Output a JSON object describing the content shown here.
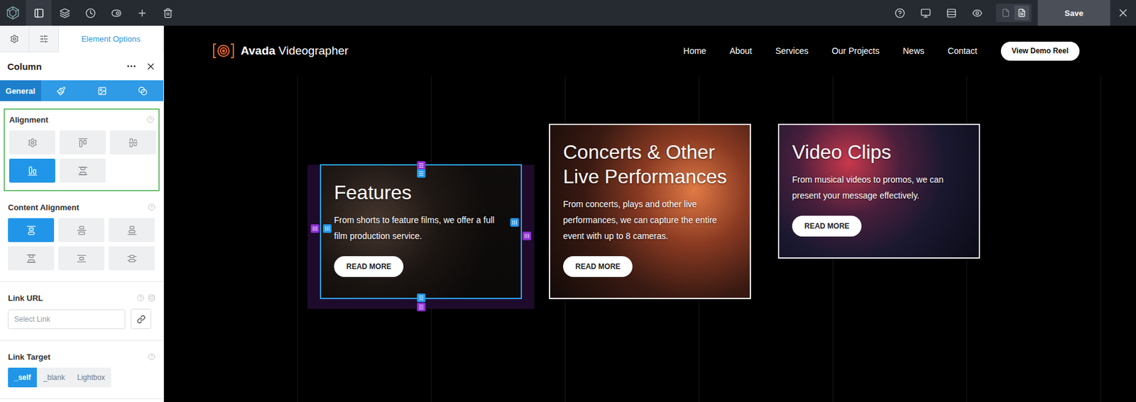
{
  "toolbar": {
    "tools": [
      {
        "kind": "panel",
        "selected": true
      },
      {
        "kind": "layers",
        "selected": false
      },
      {
        "kind": "history",
        "selected": false
      },
      {
        "kind": "toggles",
        "selected": false
      },
      {
        "kind": "add",
        "selected": false
      },
      {
        "kind": "delete",
        "selected": false
      }
    ],
    "view_tools": [
      {
        "kind": "help"
      },
      {
        "kind": "desktop"
      },
      {
        "kind": "rows"
      },
      {
        "kind": "preview"
      }
    ],
    "page_modes": [
      {
        "kind": "blank",
        "selected": false
      },
      {
        "kind": "page",
        "selected": true
      }
    ],
    "save": "Save"
  },
  "sidebar": {
    "tabs": [
      {
        "kind": "gear",
        "selected": false
      },
      {
        "kind": "sliders",
        "selected": false
      },
      {
        "kind": "text",
        "label": "Element Options",
        "selected": true
      }
    ],
    "panel_title": "Column",
    "subtabs": [
      {
        "kind": "text",
        "label": "General",
        "selected": true
      },
      {
        "kind": "design",
        "selected": false
      },
      {
        "kind": "background",
        "selected": false
      },
      {
        "kind": "extras",
        "selected": false
      }
    ],
    "alignment": {
      "label": "Alignment",
      "highlighted": true,
      "options": [
        {
          "kind": "auto",
          "selected": false
        },
        {
          "kind": "top",
          "selected": false
        },
        {
          "kind": "center",
          "selected": false
        },
        {
          "kind": "bottom",
          "selected": true
        },
        {
          "kind": "stretch",
          "selected": false
        }
      ]
    },
    "content_alignment": {
      "label": "Content Alignment",
      "options": [
        {
          "kind": "top",
          "selected": true
        },
        {
          "kind": "center",
          "selected": false
        },
        {
          "kind": "bottom",
          "selected": false
        },
        {
          "kind": "space-between",
          "selected": false
        },
        {
          "kind": "space-around",
          "selected": false
        },
        {
          "kind": "space-evenly",
          "selected": false
        }
      ]
    },
    "link_url": {
      "label": "Link URL",
      "placeholder": "Select Link"
    },
    "link_target": {
      "label": "Link Target",
      "options": [
        {
          "label": "_self",
          "selected": true
        },
        {
          "label": "_blank",
          "selected": false
        },
        {
          "label": "Lightbox",
          "selected": false
        }
      ]
    }
  },
  "site": {
    "logo_bold": "Avada",
    "logo_light": "Videographer",
    "nav": [
      "Home",
      "About",
      "Services",
      "Our Projects",
      "News",
      "Contact"
    ],
    "cta": "View Demo Reel"
  },
  "cards": [
    {
      "title": "Features",
      "text": "From shorts to feature films, we offer a full film production service.",
      "button": "READ MORE",
      "selected": true
    },
    {
      "title": "Concerts & Other Live Performances",
      "text": "From concerts, plays and other live performances, we can capture the entire event with up to 8 cameras.",
      "button": "READ MORE",
      "selected": false
    },
    {
      "title": "Video Clips",
      "text": "From musical videos to promos, we can present your message effectively.",
      "button": "READ MORE",
      "selected": false
    }
  ]
}
